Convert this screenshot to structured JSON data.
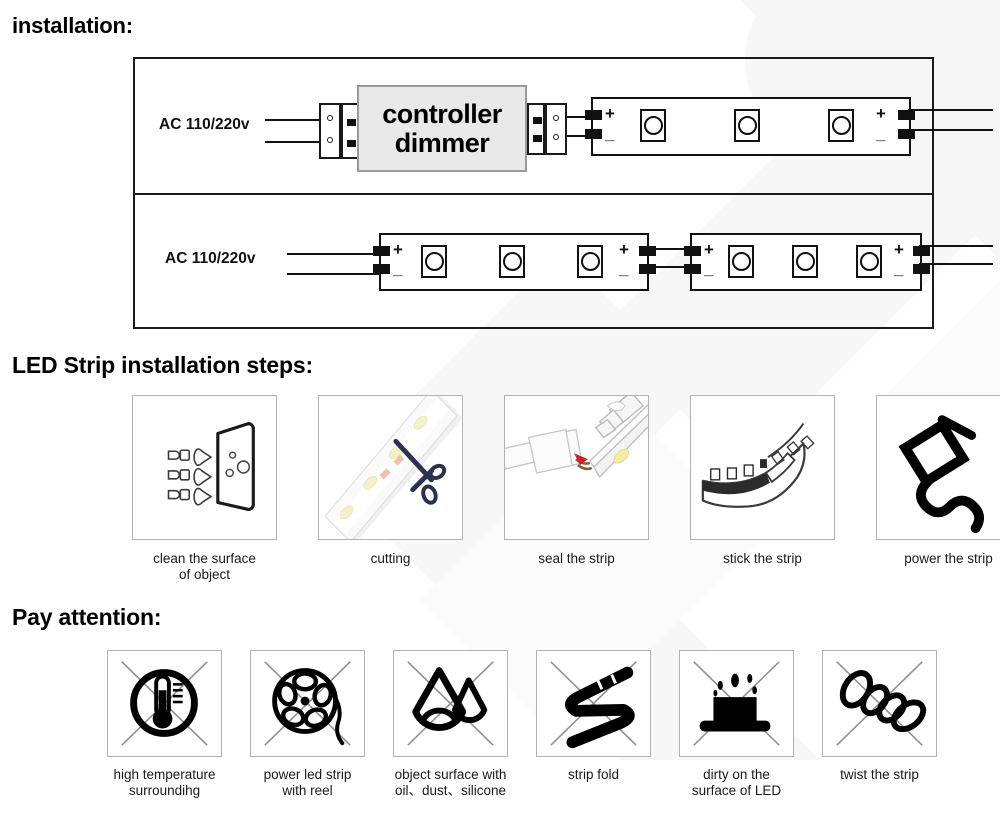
{
  "headings": {
    "installation": "installation:",
    "steps": "LED Strip installation steps:",
    "attention": "Pay attention:"
  },
  "wiring": {
    "row1": {
      "source_label": "AC 110/220v",
      "controller_line1": "controller",
      "controller_line2": "dimmer",
      "strip_plus": "+",
      "strip_minus": "_",
      "strip_out_plus": "+",
      "strip_out_minus": "_",
      "led_count": 3
    },
    "row2": {
      "source_label": "AC 110/220v",
      "strip1_plus": "+",
      "strip1_minus": "_",
      "strip1_out_plus": "+",
      "strip1_out_minus": "_",
      "strip2_plus": "+",
      "strip2_minus": "_",
      "strip2_out_plus": "+",
      "strip2_out_minus": "_",
      "led_count": 3
    }
  },
  "steps": [
    {
      "icon": "clean-surface-icon",
      "label": "clean the surface\nof object"
    },
    {
      "icon": "scissors-cutting-icon",
      "label": "cutting"
    },
    {
      "icon": "seal-glue-icon",
      "label": "seal the strip"
    },
    {
      "icon": "stick-tape-icon",
      "label": "stick the strip"
    },
    {
      "icon": "power-plug-icon",
      "label": "power the strip"
    }
  ],
  "attention": [
    {
      "icon": "high-temperature-icon",
      "label": "high temperature\nsurroundihg"
    },
    {
      "icon": "powered-reel-icon",
      "label": "power led strip\nwith reel"
    },
    {
      "icon": "oil-dust-silicone-icon",
      "label": "object surface with\noil、dust、silicone"
    },
    {
      "icon": "strip-fold-icon",
      "label": "strip fold"
    },
    {
      "icon": "dirty-led-surface-icon",
      "label": "dirty on the\nsurface of LED"
    },
    {
      "icon": "twist-strip-icon",
      "label": "twist the strip"
    }
  ],
  "colors": {
    "ink": "#111111",
    "controller_fill": "#e9e9e9",
    "card_border": "#b2b2b2",
    "scissors": "#2d3150",
    "watermark": "#f6f6f6"
  }
}
